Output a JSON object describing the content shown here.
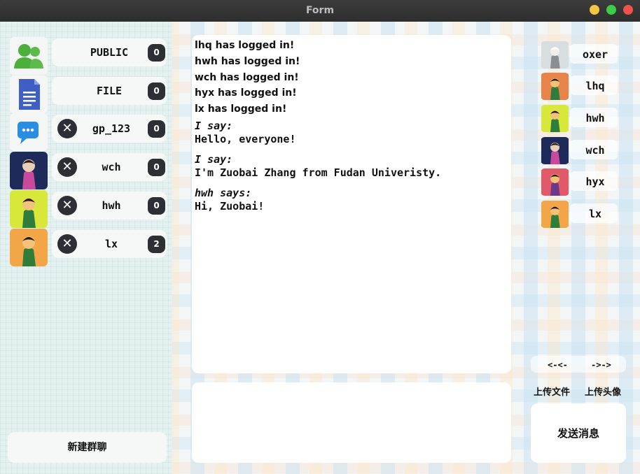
{
  "window": {
    "title": "Form"
  },
  "chats": [
    {
      "label": "PUBLIC",
      "count": "0",
      "closable": false,
      "icon": "users-icon"
    },
    {
      "label": "FILE",
      "count": "0",
      "closable": false,
      "icon": "document-icon"
    },
    {
      "label": "gp_123",
      "count": "0",
      "closable": true,
      "icon": "chat-bubble-icon"
    },
    {
      "label": "wch",
      "count": "0",
      "closable": true,
      "icon": "avatar"
    },
    {
      "label": "hwh",
      "count": "0",
      "closable": true,
      "icon": "avatar"
    },
    {
      "label": "lx",
      "count": "2",
      "closable": true,
      "icon": "avatar"
    }
  ],
  "close_glyph": "✕",
  "new_group_label": "新建群聊",
  "log_lines": [
    "lhq has logged in!",
    "hwh has logged in!",
    "wch has logged in!",
    "hyx has logged in!",
    "lx has logged in!"
  ],
  "messages": [
    {
      "sender": "I say:",
      "text": "Hello, everyone!"
    },
    {
      "sender": "I say:",
      "text": "I'm Zuobai Zhang from Fudan Univeristy."
    },
    {
      "sender": "hwh says:",
      "text": "Hi, Zuobai!"
    }
  ],
  "users": [
    "oxer",
    "lhq",
    "hwh",
    "wch",
    "hyx",
    "lx"
  ],
  "nav": {
    "prev": "<-<-",
    "next": "->->"
  },
  "upload_file_label": "上传文件",
  "upload_avatar_label": "上传头像",
  "send_label": "发送消息",
  "colors": {
    "badge_bg": "#2c2f33",
    "panel_bg": "#ffffff",
    "users_icon": "#4caf3c",
    "doc_icon": "#3f5fc4",
    "chat_icon": "#2a8de4"
  }
}
